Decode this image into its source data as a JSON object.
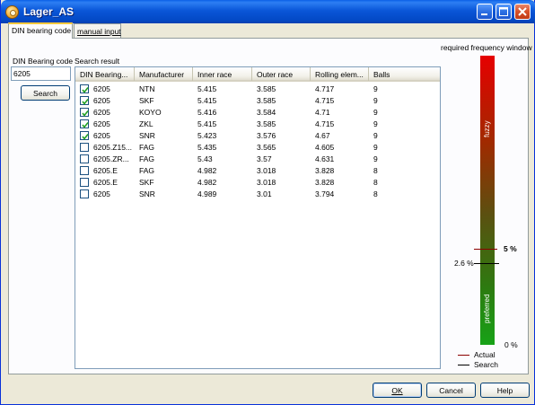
{
  "window": {
    "title": "Lager_AS"
  },
  "tabs": [
    {
      "label": "DIN bearing code",
      "active": true
    },
    {
      "label": "manual input",
      "active": false
    }
  ],
  "search": {
    "code_label": "DIN Bearing code",
    "code_value": "6205",
    "button_label": "Search",
    "result_label": "Search result"
  },
  "table": {
    "columns": [
      "DIN Bearing...",
      "Manufacturer",
      "Inner race",
      "Outer race",
      "Rolling elem...",
      "Balls"
    ],
    "rows": [
      {
        "checked": true,
        "din": "6205",
        "manufacturer": "NTN",
        "inner": "5.415",
        "outer": "3.585",
        "rolling": "4.717",
        "balls": "9"
      },
      {
        "checked": true,
        "din": "6205",
        "manufacturer": "SKF",
        "inner": "5.415",
        "outer": "3.585",
        "rolling": "4.715",
        "balls": "9"
      },
      {
        "checked": true,
        "din": "6205",
        "manufacturer": "KOYO",
        "inner": "5.416",
        "outer": "3.584",
        "rolling": "4.71",
        "balls": "9"
      },
      {
        "checked": true,
        "din": "6205",
        "manufacturer": "ZKL",
        "inner": "5.415",
        "outer": "3.585",
        "rolling": "4.715",
        "balls": "9"
      },
      {
        "checked": true,
        "din": "6205",
        "manufacturer": "SNR",
        "inner": "5.423",
        "outer": "3.576",
        "rolling": "4.67",
        "balls": "9"
      },
      {
        "checked": false,
        "din": "6205.Z15...",
        "manufacturer": "FAG",
        "inner": "5.435",
        "outer": "3.565",
        "rolling": "4.605",
        "balls": "9"
      },
      {
        "checked": false,
        "din": "6205.ZR...",
        "manufacturer": "FAG",
        "inner": "5.43",
        "outer": "3.57",
        "rolling": "4.631",
        "balls": "9"
      },
      {
        "checked": false,
        "din": "6205.E",
        "manufacturer": "FAG",
        "inner": "4.982",
        "outer": "3.018",
        "rolling": "3.828",
        "balls": "8"
      },
      {
        "checked": false,
        "din": "6205.E",
        "manufacturer": "SKF",
        "inner": "4.982",
        "outer": "3.018",
        "rolling": "3.828",
        "balls": "8"
      },
      {
        "checked": false,
        "din": "6205",
        "manufacturer": "SNR",
        "inner": "4.989",
        "outer": "3.01",
        "rolling": "3.794",
        "balls": "8"
      }
    ]
  },
  "meter": {
    "title": "required frequency window",
    "zone_top": "fuzzy",
    "zone_bottom": "preferred",
    "actual_label": "5 %",
    "actual_value": 5,
    "search_label": "2.6 %",
    "search_value": 2.6,
    "zero_label": "0 %",
    "actual_color": "#8b0000",
    "search_color": "#000000",
    "legend": {
      "actual": "Actual",
      "search": "Search"
    }
  },
  "buttons": {
    "ok": "OK",
    "cancel": "Cancel",
    "help": "Help"
  }
}
